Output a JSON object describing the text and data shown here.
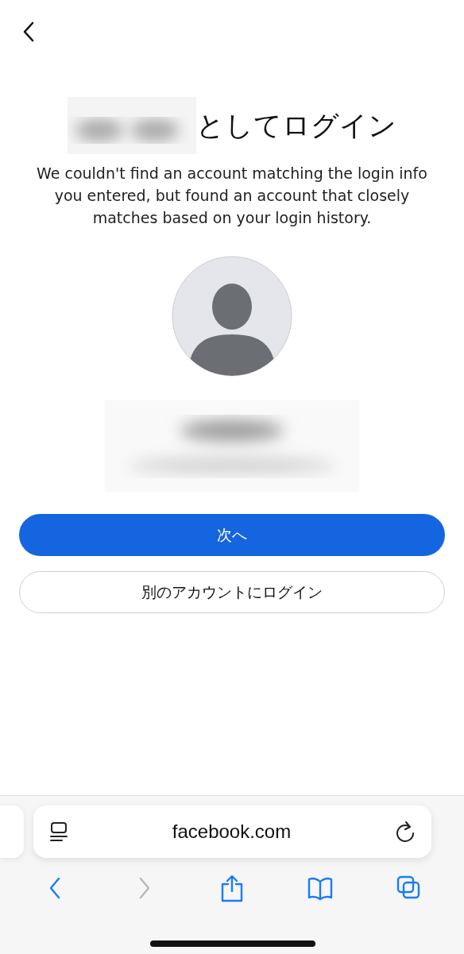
{
  "title": {
    "suffix": "としてログイン"
  },
  "message": "We couldn't find an account matching the login info you entered, but found an account that closely matches based on your login history.",
  "buttons": [
    {
      "label": "次へ",
      "kind": "primary"
    },
    {
      "label": "別のアカウントにログイン",
      "kind": "secondary"
    }
  ],
  "browser": {
    "url": "facebook.com",
    "toolbar": [
      {
        "kind": "back",
        "disabled": false
      },
      {
        "kind": "forward",
        "disabled": true
      },
      {
        "kind": "share",
        "disabled": false
      },
      {
        "kind": "bookmarks",
        "disabled": false
      },
      {
        "kind": "tabs",
        "disabled": false
      }
    ]
  }
}
